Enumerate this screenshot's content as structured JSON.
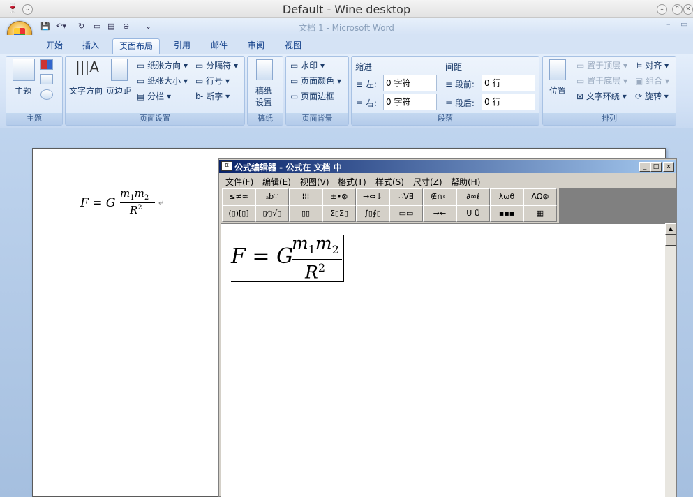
{
  "window": {
    "title": "Default - Wine desktop"
  },
  "word": {
    "title": "文档 1 - Microsoft Word"
  },
  "tabs": [
    "开始",
    "插入",
    "页面布局",
    "引用",
    "邮件",
    "审阅",
    "视图"
  ],
  "ribbon": {
    "theme": {
      "btn": "主题",
      "label": "主题"
    },
    "page_setup": {
      "text_dir": "文字方向",
      "margins": "页边距",
      "orientation": "纸张方向",
      "size": "纸张大小",
      "columns": "分栏",
      "breaks": "分隔符",
      "line_numbers": "行号",
      "hyphenation": "断字",
      "label": "页面设置"
    },
    "draft": {
      "btn": "稿纸设置",
      "btn1": "稿纸",
      "btn2": "设置",
      "label": "稿纸"
    },
    "background": {
      "watermark": "水印",
      "color": "页面颜色",
      "border": "页面边框",
      "label": "页面背景"
    },
    "paragraph": {
      "indent": "缩进",
      "left": "左:",
      "right": "右:",
      "left_val": "0 字符",
      "right_val": "0 字符",
      "spacing": "间距",
      "before": "段前:",
      "after": "段后:",
      "before_val": "0 行",
      "after_val": "0 行",
      "label": "段落"
    },
    "arrange": {
      "position": "位置",
      "front": "置于顶层",
      "back": "置于底层",
      "wrap": "文字环绕",
      "align": "对齐",
      "group": "组合",
      "rotate": "旋转",
      "label": "排列"
    }
  },
  "document": {
    "F": "F",
    "eq": "=",
    "G": "G",
    "num": "m",
    "sub1": "1",
    "sub2": "2",
    "den": "R",
    "sup": "2"
  },
  "editor": {
    "title": "公式编辑器 - 公式在 文档  中",
    "menu": [
      "文件(F)",
      "编辑(E)",
      "视图(V)",
      "格式(T)",
      "样式(S)",
      "尺寸(Z)",
      "帮助(H)"
    ],
    "palette_row1": [
      "≤≠≈",
      "ₐb∵",
      "⁞⁞⁞",
      "±•⊗",
      "→⇔↓",
      "∴∀∃",
      "∉∩⊂",
      "∂∞ℓ",
      "λωθ",
      "ΛΩ⊛"
    ],
    "palette_row2": [
      "(▯)[▯]",
      "▯⁄▯√▯",
      "▯▯",
      "Σ▯Σ▯",
      "∫▯∮▯",
      "▭▭",
      "→←",
      "Ū Ů",
      "▪▪▪",
      "▦"
    ]
  }
}
